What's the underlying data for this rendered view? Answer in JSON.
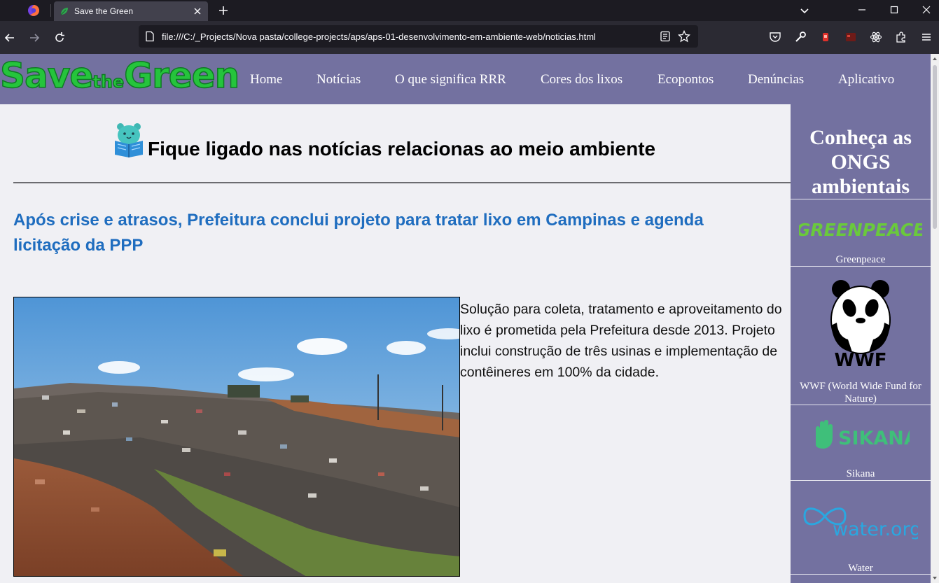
{
  "browser": {
    "tab_title": "Save the Green",
    "url": "file:///C:/_Projects/Nova pasta/college-projects/aps/aps-01-desenvolvimento-em-ambiente-web/noticias.html"
  },
  "site": {
    "logo": {
      "part1": "Save",
      "part2": "the",
      "part3": "Green"
    },
    "nav": [
      "Home",
      "Notícias",
      "O que significa RRR",
      "Cores dos lixos",
      "Ecopontos",
      "Denúncias",
      "Aplicativo"
    ]
  },
  "main": {
    "page_title": "Fique ligado nas notícias relacionas ao meio ambiente",
    "article": {
      "title": "Após crise e atrasos, Prefeitura conclui projeto para tratar lixo em Campinas e agenda licitação da PPP",
      "summary": "Solução para coleta, tratamento e aproveitamento do lixo é prometida pela Prefeitura desde 2013. Projeto inclui construção de três usinas e implementação de contêineres em 100% da cidade."
    }
  },
  "sidebar": {
    "title": "Conheça as ONGS ambientais",
    "ngos": [
      {
        "label": "Greenpeace",
        "logo_text": "GREENPEACE"
      },
      {
        "label": "WWF (World Wide Fund for Nature)",
        "logo_text": "WWF"
      },
      {
        "label": "Sikana",
        "logo_text": "SIKANA"
      },
      {
        "label": "Water",
        "logo_text": "water.org"
      }
    ]
  },
  "colors": {
    "header_bg": "#7371a0",
    "article_title": "#1f6dbf",
    "logo_green": "#25c43c",
    "page_bg": "#f0f0f4"
  }
}
